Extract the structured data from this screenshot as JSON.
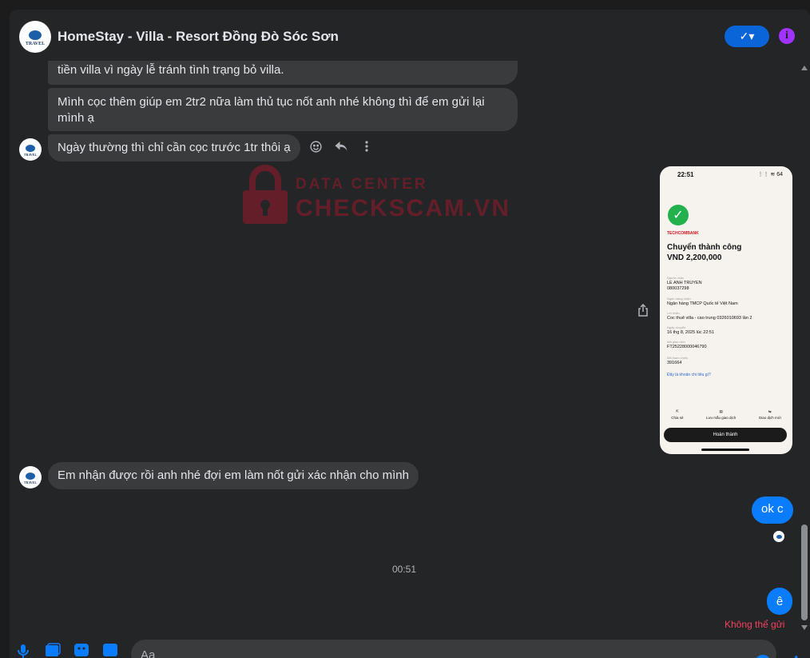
{
  "header": {
    "title": "HomeStay - Villa - Resort Đồng Đò Sóc Sơn",
    "avatar_text": "TRAVEL",
    "verify_label": "✓▾",
    "info_label": "i"
  },
  "messages": {
    "m1": "tiền villa vì ngày lễ tránh tình trạng bỏ villa.",
    "m2": "Mình cọc thêm giúp em 2tr2 nữa làm thủ tục nốt anh nhé không thì để em gửi lại mình ạ",
    "m3": "Ngày thường thì chỉ cần cọc trước 1tr thôi ạ",
    "m4": "Em nhận được rồi anh nhé đợi em làm nốt gửi xác nhận cho mình",
    "sent1": "ok c",
    "timestamp": "00:51",
    "sent2": "ê",
    "fail_status": "Không thể gửi"
  },
  "watermark": {
    "line1": "DATA CENTER",
    "line2": "CHECKSCAM.VN"
  },
  "receipt": {
    "time": "22:51",
    "status_icons": "⋮⋮ ≋ 64",
    "bank_name": "TECHCOMBANK",
    "title": "Chuyển thành công",
    "amount": "VND 2,200,000",
    "fields": [
      {
        "label": "Người nhận",
        "value": "LE ANH TRUYEN\n080037298"
      },
      {
        "label": "Ngân hàng nhận",
        "value": "Ngân hàng TMCP Quốc tế Việt Nam"
      },
      {
        "label": "Lời nhắn",
        "value": "Coc thuê villa - cao trung 0326010693 lần 2"
      },
      {
        "label": "Ngày chuyển",
        "value": "16 thg 8, 2025 lúc 22:51"
      },
      {
        "label": "Mã giao dịch",
        "value": "FT25228000046790"
      },
      {
        "label": "Mã tham chiếu",
        "value": "391664"
      }
    ],
    "link": "Đây là khoản chi tiêu gì?",
    "actions": [
      "Chia sẻ",
      "Lưu mẫu giao dịch",
      "Giao dịch mới"
    ],
    "done_button": "Hoàn thành"
  },
  "composer": {
    "placeholder": "Aa"
  },
  "colors": {
    "accent": "#0a7cff",
    "bubble_in": "#3a3b3c",
    "background": "#242526",
    "error": "#f3425f",
    "info": "#a033ff"
  }
}
